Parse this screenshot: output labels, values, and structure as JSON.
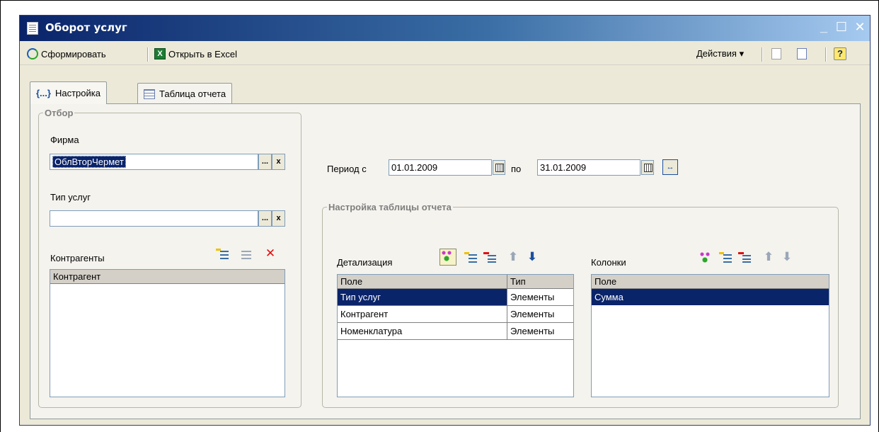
{
  "window": {
    "title": "Оборот услуг",
    "minimize_glyph": "_",
    "maximize_glyph": "☐",
    "close_glyph": "✕"
  },
  "toolbar": {
    "generate_label": "Сформировать",
    "open_excel_label": "Открыть в Excel",
    "actions_label": "Действия ▾",
    "help_glyph": "?"
  },
  "tabs": [
    {
      "label": "Настройка",
      "icon": "braces-icon",
      "icon_glyph": "{...}",
      "active": true
    },
    {
      "label": "Таблица отчета",
      "icon": "table-icon",
      "active": false
    }
  ],
  "filter": {
    "legend": "Отбор",
    "firm_label": "Фирма",
    "firm_value": "ОблВторЧермет",
    "service_type_label": "Тип услуг",
    "service_type_value": "",
    "contractors_label": "Контрагенты",
    "contractors_column": "Контрагент",
    "ellipsis_glyph": "...",
    "clear_glyph": "x",
    "delete_glyph": "✕"
  },
  "period": {
    "from_label": "Период с",
    "from_value": "01.01.2009",
    "to_label": "по",
    "to_value": "31.01.2009",
    "period_button_glyph": "↔"
  },
  "report_settings": {
    "legend": "Настройка таблицы отчета",
    "detail_label": "Детализация",
    "detail_columns": [
      "Поле",
      "Тип"
    ],
    "detail_rows": [
      {
        "field": "Тип услуг",
        "type": "Элементы",
        "selected": true
      },
      {
        "field": "Контрагент",
        "type": "Элементы",
        "selected": false
      },
      {
        "field": "Номенклатура",
        "type": "Элементы",
        "selected": false
      }
    ],
    "columns_label": "Колонки",
    "columns_header": "Поле",
    "columns_rows": [
      {
        "field": "Сумма",
        "selected": true
      }
    ],
    "up_glyph": "⬆",
    "down_glyph": "⬇",
    "delete_glyph": "✕"
  },
  "colors": {
    "selection": "#0a246a",
    "window_bg": "#ece9d8",
    "titlebar": "#0a246a"
  }
}
